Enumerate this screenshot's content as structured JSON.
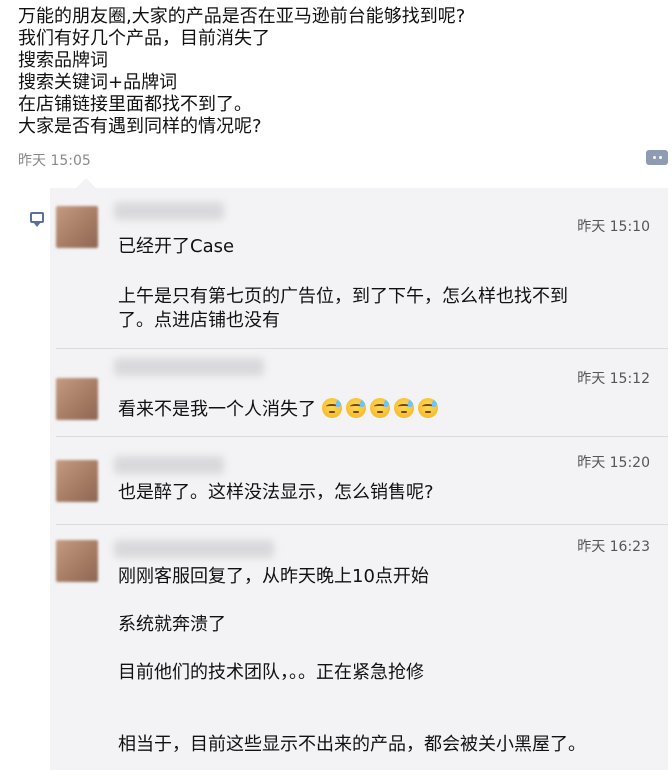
{
  "post": {
    "lines": [
      "万能的朋友圈,大家的产品是否在亚马逊前台能够找到呢?",
      "我们有好几个产品，目前消失了",
      "搜索品牌词",
      "搜索关键词+品牌词",
      "在店铺链接里面都找不到了。",
      "大家是否有遇到同样的情况呢?"
    ],
    "time": "昨天 15:05"
  },
  "comments": [
    {
      "time": "昨天 15:10",
      "paragraphs": [
        "已经开了Case",
        "上午是只有第七页的广告位，到了下午，怎么样也找不到",
        "了。点进店铺也没有"
      ]
    },
    {
      "time": "昨天 15:12",
      "paragraphs": [
        "看来不是我一个人消失了"
      ],
      "emoji": "sweat-emoji"
    },
    {
      "time": "昨天 15:20",
      "paragraphs": [
        "也是醉了。这样没法显示，怎么销售呢?"
      ]
    },
    {
      "time": "昨天 16:23",
      "paragraphs": [
        "刚刚客服回复了，从昨天晚上10点开始",
        "系统就奔溃了",
        "目前他们的技术团队，。。正在紧急抢修",
        "相当于，目前这些显示不出来的产品，都会被关小黑屋了。"
      ]
    }
  ],
  "colors": {
    "comment_bg": "#f3f3f5",
    "time_gray": "#8a8a8a",
    "icon_blue": "#5b6fa0"
  }
}
